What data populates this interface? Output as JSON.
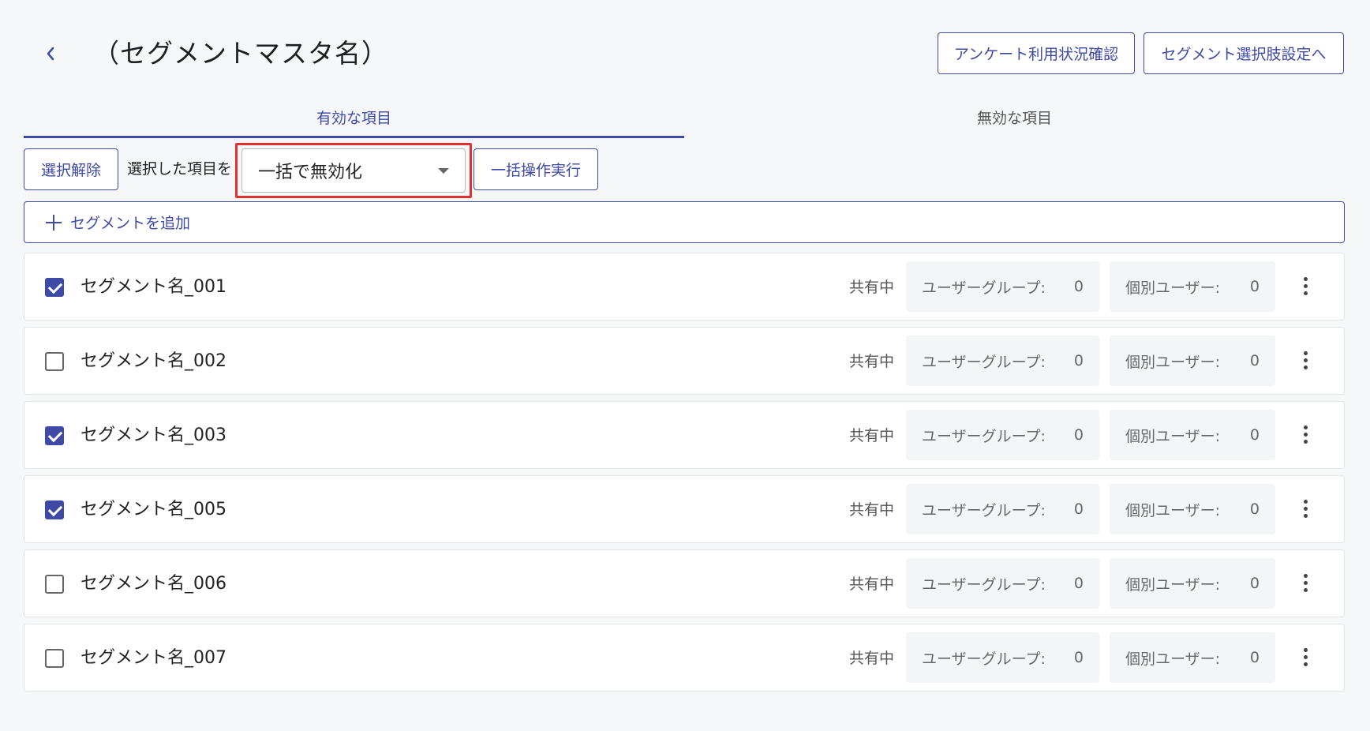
{
  "header": {
    "title": "（セグメントマスタ名）",
    "usage_button": "アンケート利用状況確認",
    "choice_button": "セグメント選択肢設定へ"
  },
  "tabs": [
    {
      "label": "有効な項目",
      "active": true
    },
    {
      "label": "無効な項目",
      "active": false
    }
  ],
  "bulk": {
    "deselect_label": "選択解除",
    "selected_label": "選択した項目を",
    "selected_action": "一括で無効化",
    "execute_label": "一括操作実行"
  },
  "add_segment": {
    "label": "セグメントを追加"
  },
  "segments": [
    {
      "name": "セグメント名_001",
      "checked": true,
      "status": "共有中",
      "group_label": "ユーザーグループ:",
      "group_count": "0",
      "user_label": "個別ユーザー:",
      "user_count": "0"
    },
    {
      "name": "セグメント名_002",
      "checked": false,
      "status": "共有中",
      "group_label": "ユーザーグループ:",
      "group_count": "0",
      "user_label": "個別ユーザー:",
      "user_count": "0"
    },
    {
      "name": "セグメント名_003",
      "checked": true,
      "status": "共有中",
      "group_label": "ユーザーグループ:",
      "group_count": "0",
      "user_label": "個別ユーザー:",
      "user_count": "0"
    },
    {
      "name": "セグメント名_005",
      "checked": true,
      "status": "共有中",
      "group_label": "ユーザーグループ:",
      "group_count": "0",
      "user_label": "個別ユーザー:",
      "user_count": "0"
    },
    {
      "name": "セグメント名_006",
      "checked": false,
      "status": "共有中",
      "group_label": "ユーザーグループ:",
      "group_count": "0",
      "user_label": "個別ユーザー:",
      "user_count": "0"
    },
    {
      "name": "セグメント名_007",
      "checked": false,
      "status": "共有中",
      "group_label": "ユーザーグループ:",
      "group_count": "0",
      "user_label": "個別ユーザー:",
      "user_count": "0"
    }
  ],
  "colors": {
    "accent": "#3f4aa6",
    "highlight": "#e03030"
  }
}
